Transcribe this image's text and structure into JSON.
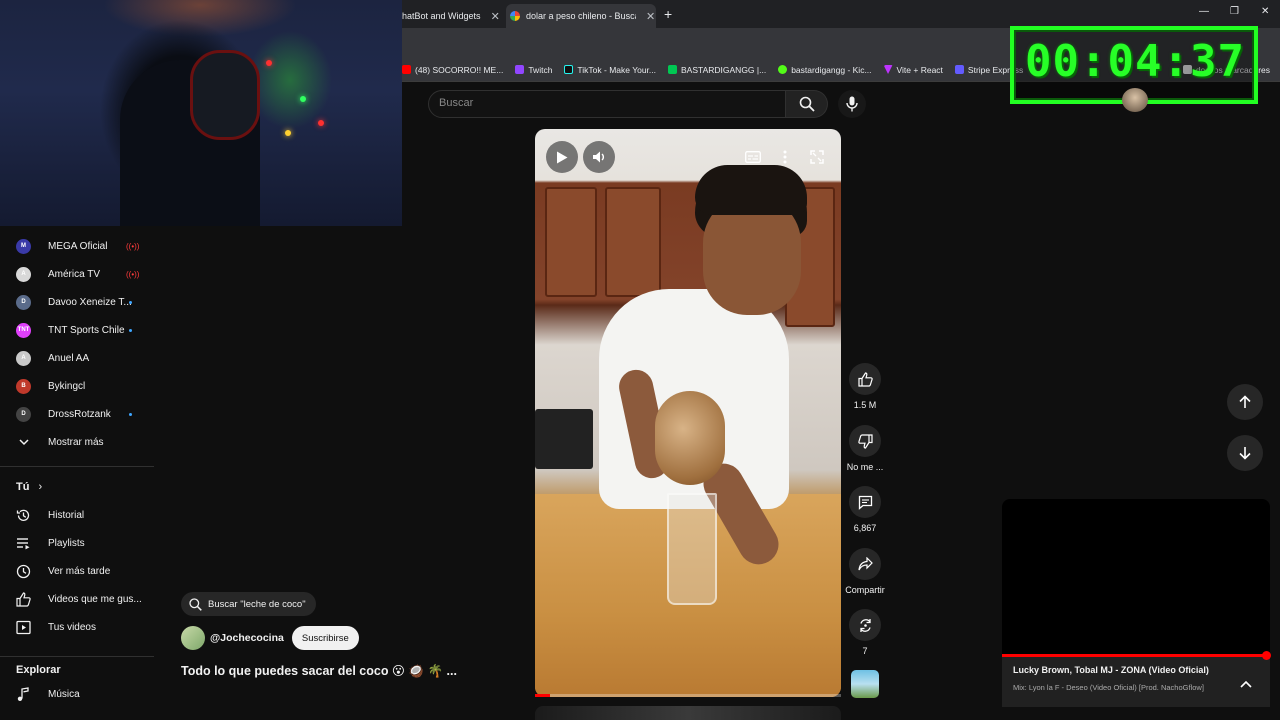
{
  "browser": {
    "tabs": [
      {
        "title": "hatBot and Widgets",
        "active": false
      },
      {
        "title": "dolar a peso chileno - Buscar co",
        "active": true
      }
    ],
    "bookmarks": [
      {
        "label": "(48) SOCORRO!! ME...",
        "color": "#ff0000"
      },
      {
        "label": "Twitch",
        "color": "#9146ff"
      },
      {
        "label": "TikTok - Make Your...",
        "color": "#111111"
      },
      {
        "label": "BASTARDIGANGG |...",
        "color": "#00c853"
      },
      {
        "label": "bastardigangg - Kic...",
        "color": "#53fc18"
      },
      {
        "label": "Vite + React",
        "color": "#bd34fe"
      },
      {
        "label": "Stripe Express",
        "color": "#635bff"
      }
    ],
    "bookmarks_tail": "dos los marcadores"
  },
  "timer": {
    "text": "00:04:37",
    "color": "#22ff22"
  },
  "search": {
    "placeholder": "Buscar"
  },
  "sidebar": {
    "subscriptions": [
      {
        "label": "MEGA Oficial",
        "status": "live",
        "avatar_color": "#3a3aa8",
        "avatar_text": "M"
      },
      {
        "label": "América TV",
        "status": "live",
        "avatar_color": "#d8d8d8",
        "avatar_text": "A"
      },
      {
        "label": "Davoo Xeneize T...",
        "status": "new",
        "avatar_color": "#5a6b8a",
        "avatar_text": "D"
      },
      {
        "label": "TNT Sports Chile",
        "status": "new",
        "avatar_color": "#e040fb",
        "avatar_text": "TNT"
      },
      {
        "label": "Anuel AA",
        "status": "none",
        "avatar_color": "#c9c9c9",
        "avatar_text": "A"
      },
      {
        "label": "Bykingcl",
        "status": "none",
        "avatar_color": "#c0392b",
        "avatar_text": "B"
      },
      {
        "label": "DrossRotzank",
        "status": "new",
        "avatar_color": "#444444",
        "avatar_text": "D"
      }
    ],
    "show_more": "Mostrar más",
    "you_header": "Tú",
    "you_items": [
      {
        "label": "Historial",
        "icon": "history-icon"
      },
      {
        "label": "Playlists",
        "icon": "playlists-icon"
      },
      {
        "label": "Ver más tarde",
        "icon": "watch-later-icon"
      },
      {
        "label": "Videos que me gus...",
        "icon": "like-icon"
      },
      {
        "label": "Tus videos",
        "icon": "your-videos-icon"
      }
    ],
    "explore_header": "Explorar",
    "explore_items": [
      {
        "label": "Música",
        "icon": "music-icon"
      }
    ],
    "live_mark": "((•))"
  },
  "short": {
    "search_chip": "Buscar \"leche de coco\"",
    "channel": "@Jochecocina",
    "subscribe": "Suscribirse",
    "title": "Todo lo que puedes sacar del coco 😮 🥥 🌴 ...",
    "progress": 0.05,
    "actions": {
      "like": "1.5 M",
      "dislike": "No me ...",
      "comments": "6,867",
      "share": "Compartir",
      "remix": "7"
    }
  },
  "mini_player": {
    "title": "Lucky Brown, Tobal MJ - ZONA (Video Oficial)",
    "subtitle": "Mix: Lyon la F - Deseo (Video Oficial) [Prod. NachoGflow]",
    "progress": 0.99
  }
}
